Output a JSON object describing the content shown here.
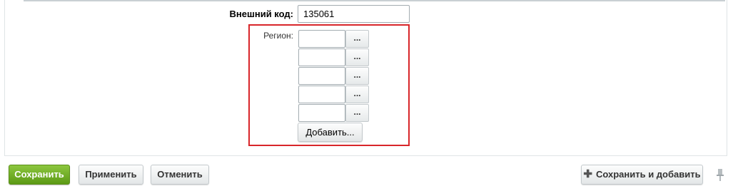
{
  "form": {
    "external_code_label": "Внешний код:",
    "external_code_value": "135061",
    "region_label": "Регион:",
    "region_rows": [
      {
        "value": "",
        "picker_label": "..."
      },
      {
        "value": "",
        "picker_label": "..."
      },
      {
        "value": "",
        "picker_label": "..."
      },
      {
        "value": "",
        "picker_label": "..."
      },
      {
        "value": "",
        "picker_label": "..."
      }
    ],
    "add_button_label": "Добавить..."
  },
  "footer": {
    "save_label": "Сохранить",
    "apply_label": "Применить",
    "cancel_label": "Отменить",
    "save_and_add_label": "Сохранить и добавить",
    "save_and_add_icon": "plus-icon",
    "pin_icon": "pin-icon"
  },
  "colors": {
    "highlight_border": "#d8262a",
    "primary_button": "#6aab1f"
  }
}
